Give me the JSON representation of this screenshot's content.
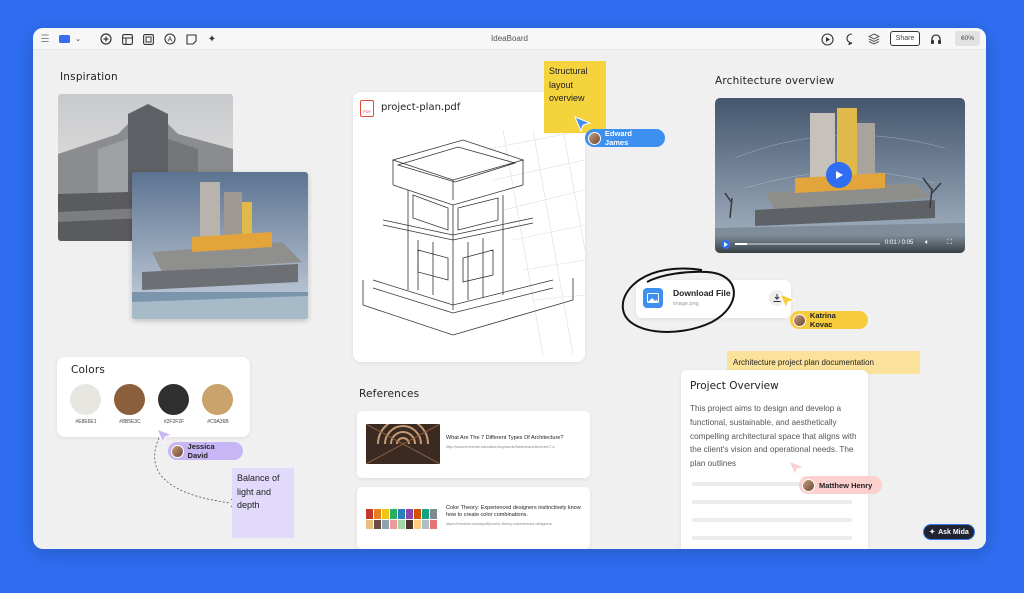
{
  "app": {
    "title": "IdeaBoard",
    "share_label": "Share",
    "zoom": "60%"
  },
  "toolbar": {
    "icons": [
      "menu-icon",
      "frame-icon",
      "chevron-down-icon",
      "plus-circle-icon",
      "layout-icon",
      "media-icon",
      "at-icon",
      "sticky-note-icon",
      "sparkle-icon"
    ],
    "right_icons": [
      "play-icon",
      "comment-icon",
      "layers-icon",
      "headphones-icon"
    ]
  },
  "inspiration": {
    "title": "Inspiration"
  },
  "pdf": {
    "filename": "project-plan.pdf",
    "icon": "pdf-icon"
  },
  "sticky_structural": {
    "text": "Structural layout overview",
    "color": "#f5d33c"
  },
  "edward": {
    "name": "Edward James",
    "color": "#3d8ff0"
  },
  "architecture": {
    "title": "Architecture overview",
    "time": "0:01 / 0:05"
  },
  "download": {
    "title": "Download File",
    "subtitle": "image.png"
  },
  "katrina": {
    "name": "Katrina Kovac",
    "color": "#f6cc3c"
  },
  "note_architecture": {
    "text": "Architecture project plan documentation",
    "color": "#fbe29a"
  },
  "colors": {
    "title": "Colors",
    "swatches": [
      {
        "hex": "#E8E6E1",
        "label": "#E8E6E1"
      },
      {
        "hex": "#8B5E3C",
        "label": "#8B5E3C"
      },
      {
        "hex": "#2F2F2F",
        "label": "#2F2F2F"
      },
      {
        "hex": "#C9A36B",
        "label": "#C9A36B"
      }
    ]
  },
  "jessica": {
    "name": "Jessica David",
    "color": "#c7b6f5"
  },
  "sticky_balance": {
    "text": "Balance of light and depth",
    "color": "#e2dafa"
  },
  "references": {
    "title": "References",
    "items": [
      {
        "title": "What Are The 7 Different Types Of Architecture?",
        "url": "http://www.immense.education/keywords/folders/architecture/7-d"
      },
      {
        "title": "Color Theory: Experienced designers instinctively know how to create color combinations.",
        "url": "https://medium.com/spotify/color-theory-experienced-designers"
      }
    ]
  },
  "overview": {
    "title": "Project Overview",
    "body": "This project aims to design and develop a functional, sustainable, and aesthetically compelling architectural space that aligns with the client's vision and operational needs. The plan outlines"
  },
  "matthew": {
    "name": "Matthew Henry",
    "color": "#fbd0cf"
  },
  "ask": {
    "label": "Ask Mida"
  }
}
